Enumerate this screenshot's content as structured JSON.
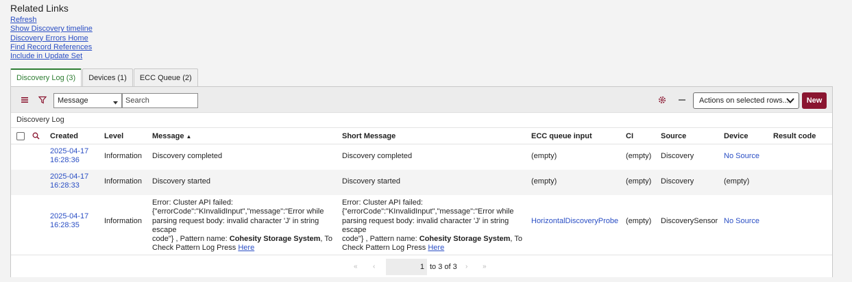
{
  "related_links": {
    "title": "Related Links",
    "links": [
      "Refresh",
      "Show Discovery timeline",
      "Discovery Errors Home",
      "Find Record References",
      "Include in Update Set"
    ]
  },
  "tabs": [
    {
      "label": "Discovery Log (3)",
      "active": true
    },
    {
      "label": "Devices (1)",
      "active": false
    },
    {
      "label": "ECC Queue (2)",
      "active": false
    }
  ],
  "toolbar": {
    "field_select": "Message",
    "search_placeholder": "Search",
    "actions_label": "Actions on selected rows...",
    "new_label": "New"
  },
  "list_title": "Discovery Log",
  "columns": [
    "Created",
    "Level",
    "Message",
    "Short Message",
    "ECC queue input",
    "CI",
    "Source",
    "Device",
    "Result code"
  ],
  "sort_indicator": "▲",
  "rows": [
    {
      "created_date": "2025-04-17",
      "created_time": "16:28:36",
      "level": "Information",
      "message": "Discovery completed",
      "short_message": "Discovery completed",
      "ecc": "(empty)",
      "ci": "(empty)",
      "source": "Discovery",
      "device": "No Source",
      "result_code": ""
    },
    {
      "created_date": "2025-04-17",
      "created_time": "16:28:33",
      "level": "Information",
      "message": "Discovery started",
      "short_message": "Discovery started",
      "ecc": "(empty)",
      "ci": "(empty)",
      "source": "Discovery",
      "device": "(empty)",
      "result_code": ""
    },
    {
      "created_date": "2025-04-17",
      "created_time": "16:28:35",
      "level": "Information",
      "message_lines": [
        "Error: Cluster API failed:",
        "{\"errorCode\":\"KInvalidInput\",\"message\":\"Error while",
        "parsing request body: invalid character 'J' in string escape",
        "code\"} , Pattern name: ",
        "Check Pattern Log Press "
      ],
      "message_bold": "Cohesity Storage System",
      "message_after_bold": ", To",
      "message_link": "Here",
      "ecc": "HorizontalDiscoveryProbe",
      "ci": "(empty)",
      "source": "DiscoverySensor",
      "device": "No Source",
      "result_code": ""
    }
  ],
  "pager": {
    "page_value": "1",
    "range_text": "to 3 of 3",
    "first_icon": "«",
    "prev_icon": "‹",
    "next_icon": "›",
    "last_icon": "»"
  }
}
